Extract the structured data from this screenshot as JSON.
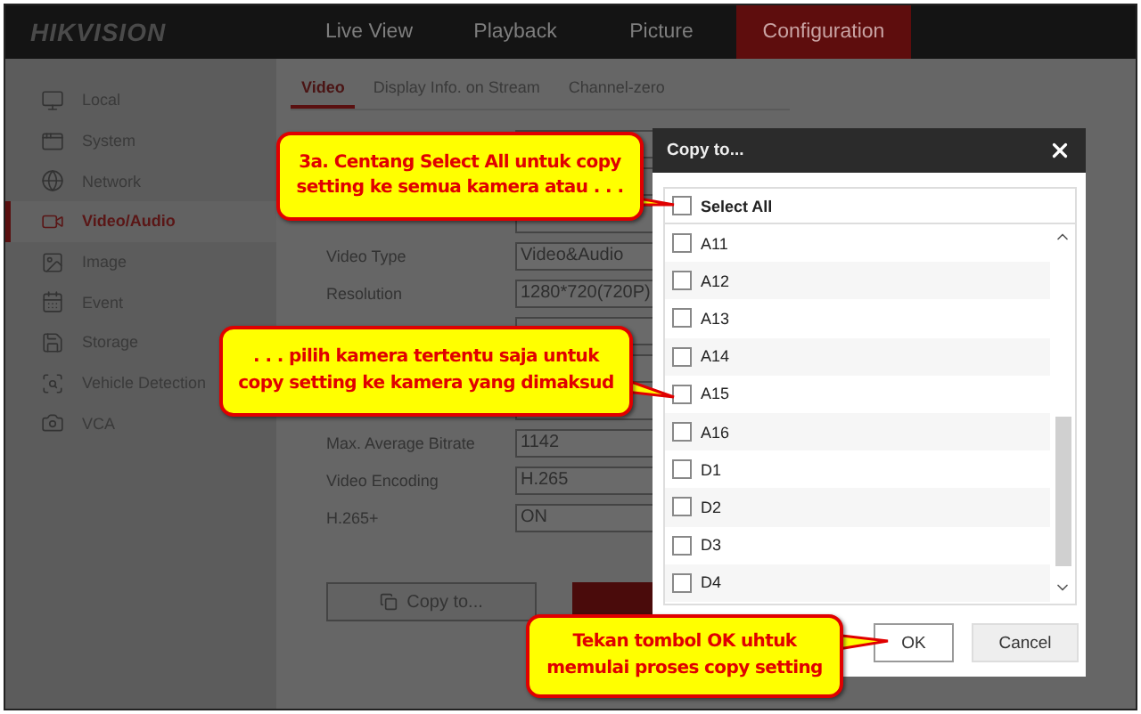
{
  "header": {
    "logo": "HIKVISION",
    "nav": [
      {
        "label": "Live View",
        "selected": false
      },
      {
        "label": "Playback",
        "selected": false
      },
      {
        "label": "Picture",
        "selected": false
      },
      {
        "label": "Configuration",
        "selected": true
      }
    ]
  },
  "sidebar": {
    "items": [
      {
        "label": "Local",
        "selected": false
      },
      {
        "label": "System",
        "selected": false
      },
      {
        "label": "Network",
        "selected": false
      },
      {
        "label": "Video/Audio",
        "selected": true
      },
      {
        "label": "Image",
        "selected": false
      },
      {
        "label": "Event",
        "selected": false
      },
      {
        "label": "Storage",
        "selected": false
      },
      {
        "label": "Vehicle Detection",
        "selected": false
      },
      {
        "label": "VCA",
        "selected": false
      }
    ]
  },
  "tabs": [
    {
      "label": "Video",
      "selected": true
    },
    {
      "label": "Display Info. on Stream",
      "selected": false
    },
    {
      "label": "Channel-zero",
      "selected": false
    }
  ],
  "form": {
    "rows": [
      {},
      {},
      {},
      {
        "label": "Video Type",
        "value": "Video&Audio"
      },
      {
        "label": "Resolution",
        "value": "1280*720(720P)"
      },
      {},
      {},
      {},
      {
        "label": "Max. Average Bitrate",
        "value": "1142"
      },
      {
        "label": "Video Encoding",
        "value": "H.265"
      },
      {
        "label": "H.265+",
        "value": "ON"
      }
    ],
    "copy_button": "Copy to..."
  },
  "dialog": {
    "title": "Copy to...",
    "select_all": {
      "label": "Select All",
      "checked": false
    },
    "channels": [
      {
        "label": "A11",
        "checked": false
      },
      {
        "label": "A12",
        "checked": false
      },
      {
        "label": "A13",
        "checked": false
      },
      {
        "label": "A14",
        "checked": false
      },
      {
        "label": "A15",
        "checked": false
      },
      {
        "label": "A16",
        "checked": false
      },
      {
        "label": "D1",
        "checked": false
      },
      {
        "label": "D2",
        "checked": false
      },
      {
        "label": "D3",
        "checked": false
      },
      {
        "label": "D4",
        "checked": false
      }
    ],
    "buttons": [
      {
        "label": "OK",
        "kind": "primary"
      },
      {
        "label": "Cancel",
        "kind": "secondary"
      }
    ]
  },
  "callouts": [
    {
      "text": "3a. Centang Select All untuk copy\nsetting ke semua kamera atau . . ."
    },
    {
      "text": ". . . pilih kamera tertentu saja untuk\ncopy setting ke kamera yang dimaksud"
    },
    {
      "text": "Tekan tombol OK uhtuk\nmemulai proses copy setting"
    }
  ]
}
